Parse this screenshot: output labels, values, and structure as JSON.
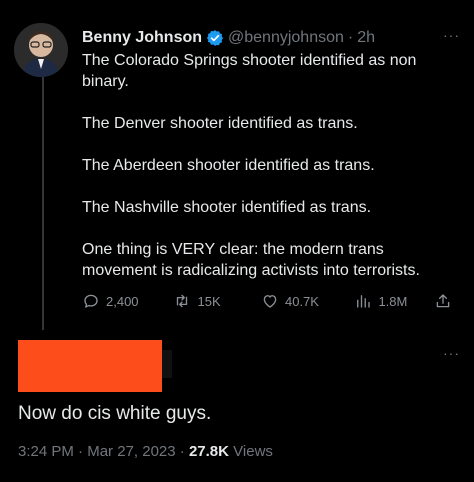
{
  "tweet": {
    "display_name": "Benny Johnson",
    "handle": "@bennyjohnson",
    "separator": "·",
    "age": "2h",
    "more_label": "···",
    "paragraphs": [
      "The Colorado Springs shooter identified as non binary.",
      "The Denver shooter identified as trans.",
      "The Aberdeen shooter identified as trans.",
      "The Nashville shooter identified as trans.",
      "One thing is VERY clear: the modern trans movement is radicalizing activists into terrorists."
    ],
    "actions": {
      "replies": "2,400",
      "reposts": "15K",
      "likes": "40.7K",
      "views": "1.8M"
    }
  },
  "reply": {
    "more_label": "···",
    "text": "Now do cis white guys.",
    "time": "3:24 PM",
    "separator": "·",
    "date": "Mar 27, 2023",
    "views_count": "27.8K",
    "views_label": "Views"
  },
  "colors": {
    "background": "#000000",
    "text": "#e7e9ea",
    "muted": "#71767b",
    "verified": "#1d9bf0",
    "redaction": "#fd4d1a"
  },
  "icons": {
    "verified": "verified-badge-icon",
    "reply": "reply-bubble-icon",
    "repost": "repost-icon",
    "like": "heart-icon",
    "views": "bar-chart-icon",
    "share": "share-icon"
  }
}
